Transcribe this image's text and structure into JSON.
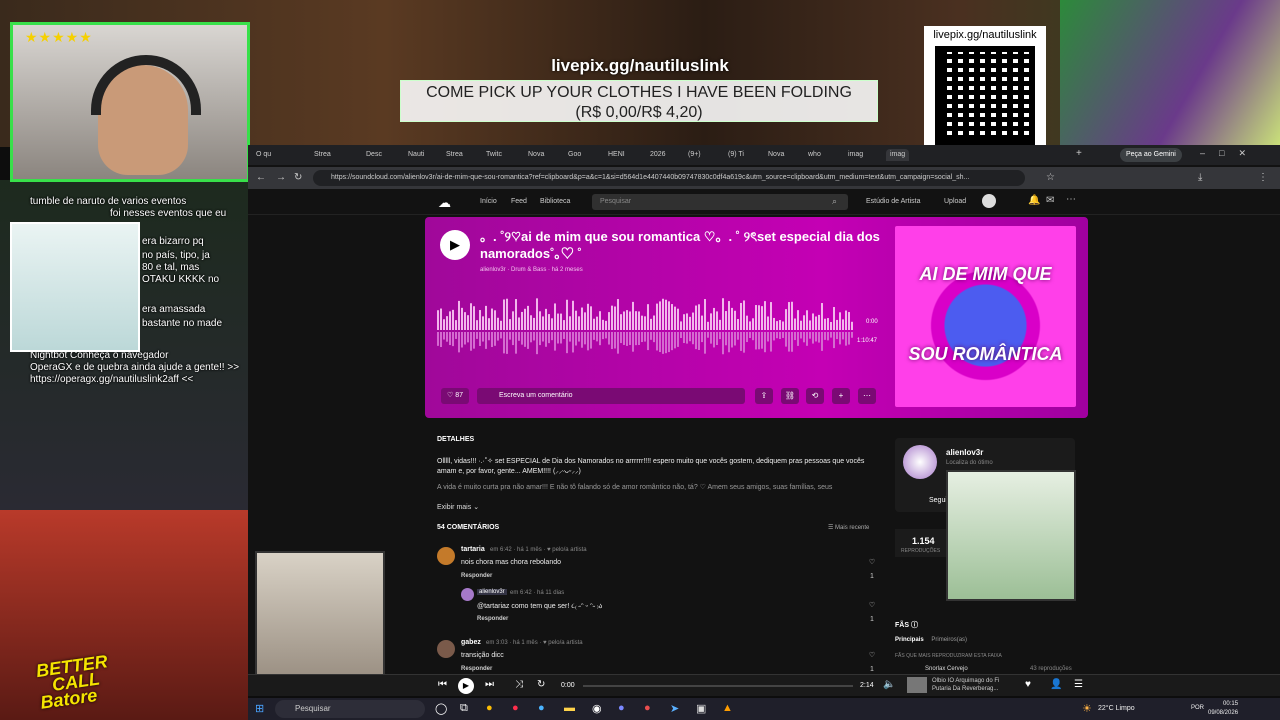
{
  "stream": {
    "donation_url": "livepix.gg/nautiluslink",
    "donation_line1": "COME PICK UP YOUR CLOTHES I HAVE BEEN FOLDING",
    "donation_line2": "(R$ 0,00/R$ 4,20)",
    "qr_label": "livepix.gg/nautiluslink",
    "stars": "★★★★★",
    "chat": [
      "tumble de naruto de varios eventos",
      "foi nesses eventos que eu",
      "era bizarro pq",
      "no país, tipo, ja",
      "80 e tal, mas",
      "OTAKU KKKK no",
      "era amassada",
      "bastante no made",
      "Nightbot  Conheça o navegador",
      "OperaGX e de quebra ainda ajude a gente!! >>",
      "https://operagx.gg/nautiluslink2aff <<"
    ],
    "bcs_line1": "BETTER",
    "bcs_line2": "CALL",
    "bcs_line3": "Batore"
  },
  "browser": {
    "tabs": [
      "O qu",
      "Strea",
      "Desc",
      "Nauti",
      "Strea",
      "Twitc",
      "Nova",
      "Goo",
      "HENI",
      "2026",
      "(9+)",
      "(9) Ti",
      "Nova",
      "who",
      "imag",
      "imag"
    ],
    "gemini": "Peça ao Gemini",
    "url": "https://soundcloud.com/alienlov3r/ai-de-mim-que-sou-romantica?ref=clipboard&p=a&c=1&si=d564d1e4407440b09747830c0df4a619c&utm_source=clipboard&utm_medium=text&utm_campaign=social_sh..."
  },
  "sc_header": {
    "home": "Início",
    "feed": "Feed",
    "library": "Biblioteca",
    "search_placeholder": "Pesquisar",
    "studio": "Estúdio de Artista",
    "upload": "Upload"
  },
  "track": {
    "title": "。. ˚୨♡ai de mim que sou romantica ♡。. ˚ ୨ৎset especial dia dos namorados˚｡♡ ˚",
    "meta": "alienlov3r · Drum & Bass · há 2 meses",
    "time_start": "0:00",
    "time_end": "1:10:47",
    "likes": "87",
    "comment_placeholder": "Escreva um comentário",
    "cover_text1": "AI DE MIM QUE",
    "cover_text2": "SOU ROMÂNTICA"
  },
  "details": {
    "heading": "DETALHES",
    "desc1": "Olllll, vidas!!! ·.·˚✧ set ESPECIAL de Dia dos Namorados no arrrrrr!!!! espero muito que vocês gostem, dediquem pras pessoas que vocês amam e, por favor, gente... AMEM!!!! (⸝⸝ᵕᴗᵕ⸝⸝)",
    "desc2": "A vida é muito curta pra não amar!!! E não tô falando só de amor romântico não, tá? ♡ Amem seus amigos, suas famílias, seus",
    "show_more": "Exibir mais",
    "comments_heading": "54 COMENTÁRIOS",
    "sort": "Mais recente"
  },
  "comments": [
    {
      "user": "tartaria",
      "meta": "em  6:42 · há 1 mês  · ♥ pelo/a artista",
      "text": "nois chora mas chora rebolando",
      "reply": "Responder",
      "likes": "1"
    },
    {
      "user": "alienlov3r",
      "meta": "em  6:42 · há 11 dias",
      "text": "@tartariaz como tem que ser! ૮₍ ˶ᵔ ᵕ ᵔ˶ ₎ა",
      "reply": "Responder",
      "likes": "1"
    },
    {
      "user": "gabez",
      "meta": "em  3:03 · há 1 mês  · ♥ pelo/a artista",
      "text": "transição dicc",
      "reply": "Responder",
      "likes": "1"
    }
  ],
  "artist": {
    "name": "alienlov3r",
    "location": "Localiza do ótimo",
    "follow": "Seguir",
    "plays": "1.154",
    "plays_label": "REPRODUÇÕES"
  },
  "fans": {
    "heading": "FÃS",
    "tab1": "Principais",
    "tab2": "Primeiros(as)",
    "sub": "FÃS QUE MAIS REPRODUZIRAM ESTA FAIXA",
    "fan1": "Snorlax Cervejo",
    "fan1_count": "43 reproduções"
  },
  "player": {
    "time_current": "0:00",
    "time_total": "2:14",
    "track_line1": "Olbio IO Arquimago do Fi",
    "track_line2": "Putaria Da Reverberag..."
  },
  "taskbar": {
    "search": "Pesquisar",
    "weather": "22°C  Limpo",
    "lang": "POR",
    "time": "00:15",
    "date": "09/08/2026"
  },
  "colors": {
    "accent": "#c400b4",
    "stream_green": "#38e04a",
    "background": "#121212"
  }
}
